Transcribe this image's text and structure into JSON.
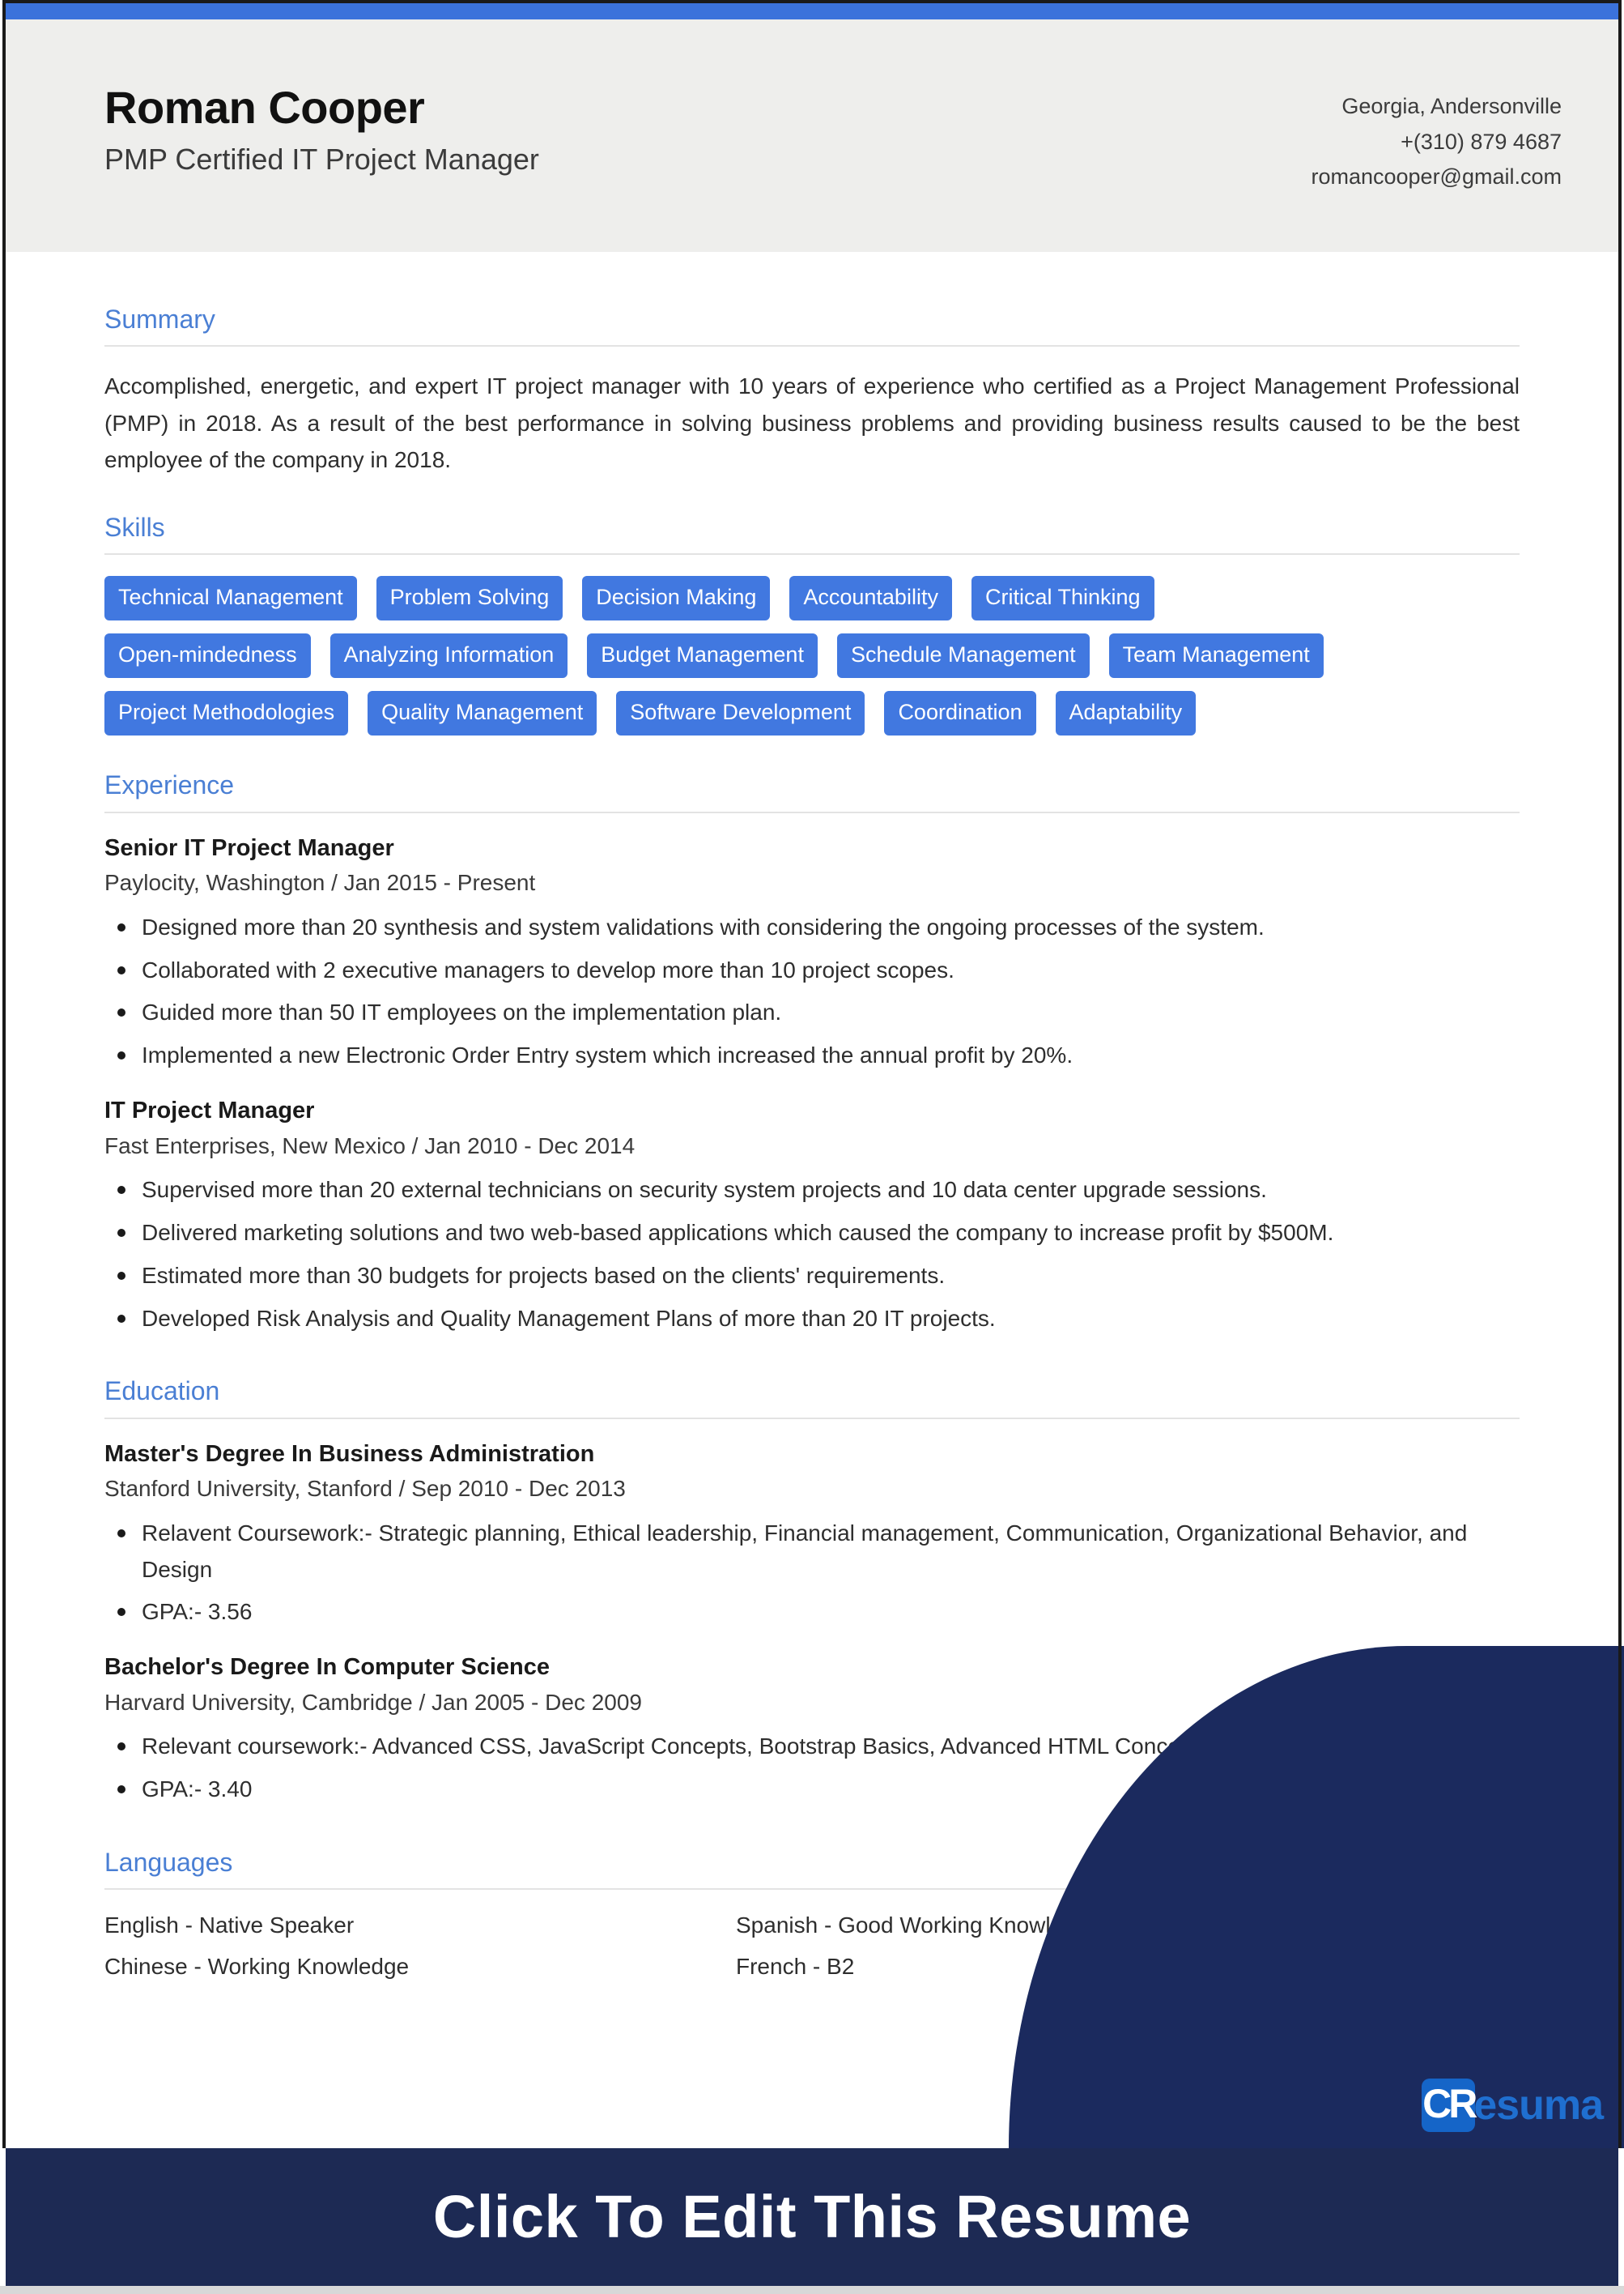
{
  "header": {
    "name": "Roman Cooper",
    "headline": "PMP Certified IT Project Manager",
    "contact": {
      "location": "Georgia, Andersonville",
      "phone": "+(310) 879 4687",
      "email": "romancooper@gmail.com"
    }
  },
  "sections": {
    "summary": {
      "title": "Summary",
      "text": "Accomplished, energetic, and expert IT project manager with 10 years of experience who certified as a Project Management Professional (PMP) in 2018. As a result of the best performance in solving business problems and providing business results caused to be the best employee of the company in 2018."
    },
    "skills": {
      "title": "Skills",
      "items": [
        "Technical Management",
        "Problem Solving",
        "Decision Making",
        "Accountability",
        "Critical Thinking",
        "Open-mindedness",
        "Analyzing Information",
        "Budget Management",
        "Schedule Management",
        "Team Management",
        "Project Methodologies",
        "Quality Management",
        "Software Development",
        "Coordination",
        "Adaptability"
      ]
    },
    "experience": {
      "title": "Experience",
      "entries": [
        {
          "job_title": "Senior IT Project Manager",
          "meta": "Paylocity, Washington / Jan 2015 - Present",
          "bullets": [
            "Designed more than 20 synthesis and system validations with considering the ongoing processes of the system.",
            "Collaborated with 2 executive managers to develop more than 10 project scopes.",
            "Guided more than 50 IT employees on the implementation plan.",
            "Implemented a new Electronic Order Entry system which increased the annual profit by 20%."
          ]
        },
        {
          "job_title": "IT Project Manager",
          "meta": "Fast Enterprises, New Mexico / Jan 2010 - Dec 2014",
          "bullets": [
            "Supervised more than 20 external technicians on security system projects and 10 data center upgrade sessions.",
            "Delivered marketing solutions and two web-based applications which caused the company to increase profit by $500M.",
            "Estimated more than 30 budgets for projects based on the clients' requirements.",
            "Developed Risk Analysis and Quality Management Plans of more than 20 IT projects."
          ]
        }
      ]
    },
    "education": {
      "title": "Education",
      "entries": [
        {
          "degree": "Master's Degree In Business Administration",
          "meta": "Stanford University, Stanford / Sep 2010 - Dec 2013",
          "bullets": [
            "Relavent Coursework:- Strategic planning, Ethical leadership, Financial management, Communication, Organizational Behavior, and Design",
            "GPA:- 3.56"
          ]
        },
        {
          "degree": "Bachelor's Degree In Computer Science",
          "meta": "Harvard University, Cambridge / Jan 2005 - Dec 2009",
          "bullets": [
            "Relevant coursework:- Advanced CSS, JavaScript Concepts,  Bootstrap Basics, Advanced HTML Concepts",
            "GPA:- 3.40"
          ]
        }
      ]
    },
    "languages": {
      "title": "Languages",
      "items": [
        "English - Native Speaker",
        "Spanish - Good Working Knowledge",
        "Chinese - Working Knowledge",
        "French - B2"
      ]
    }
  },
  "branding": {
    "logo_mark": "CR",
    "logo_text": "esuma"
  },
  "cta": {
    "label": "Click To Edit This Resume"
  },
  "colors": {
    "accent_blue": "#3b72db",
    "heading_blue": "#4a7fd4",
    "chip_blue": "#4178e0",
    "navy": "#1b2a5e",
    "banner_navy": "#1d2a54",
    "header_gray": "#eeeeec"
  }
}
